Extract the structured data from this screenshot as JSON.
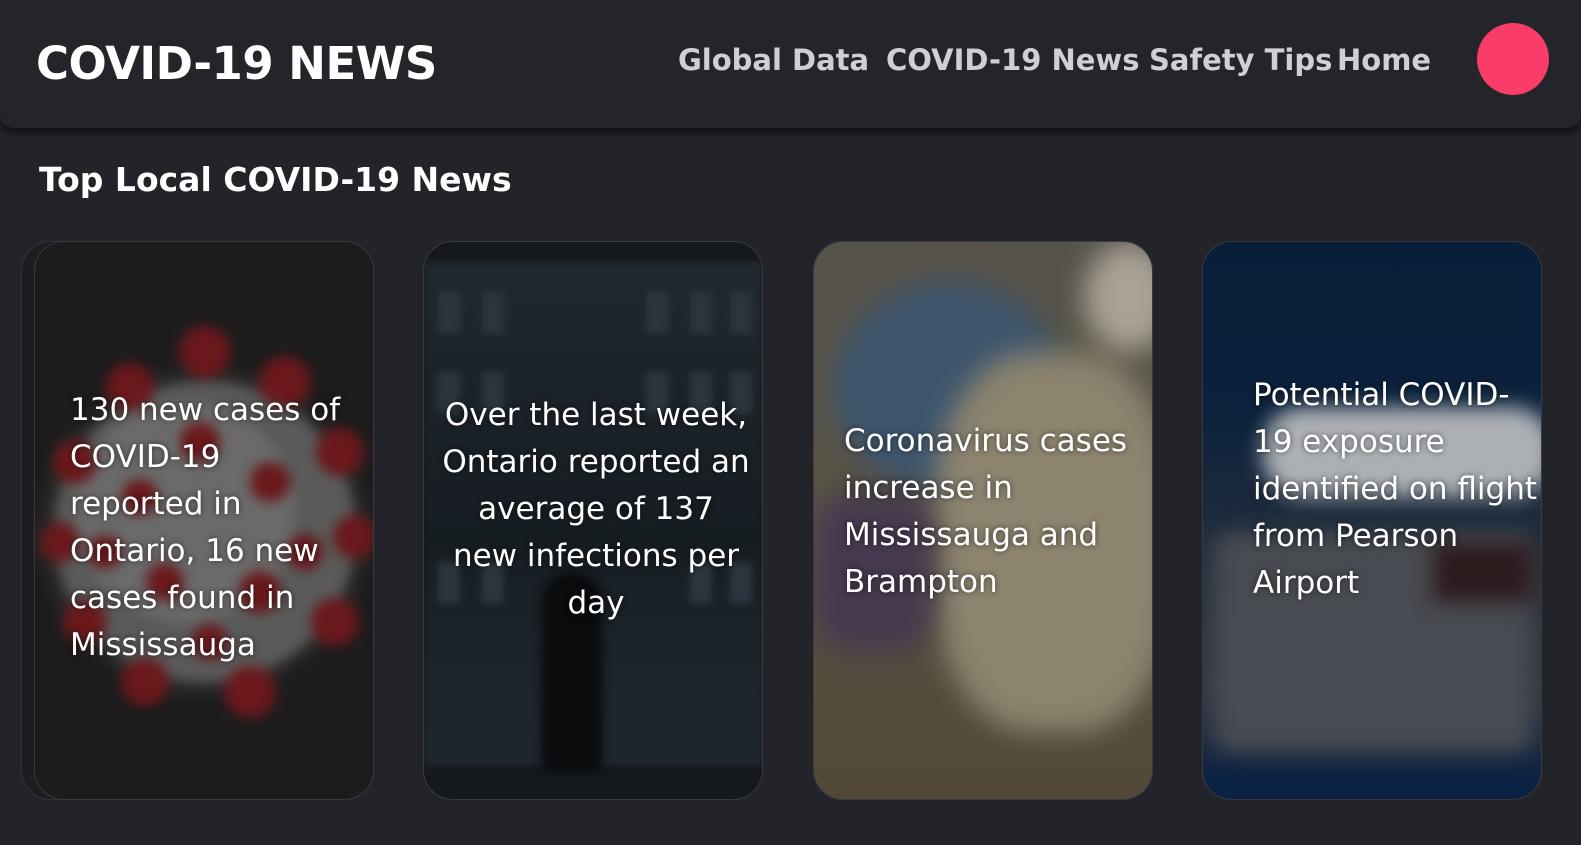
{
  "header": {
    "brand": "COVID-19 NEWS",
    "nav": {
      "global_data": "Global Data",
      "covid_news": "COVID-19 News",
      "safety_tips": "Safety Tips",
      "home": "Home"
    },
    "avatar_color": "#fa3d68"
  },
  "main": {
    "section_title": "Top Local COVID-19 News",
    "cards": [
      {
        "headline": "130 new cases of COVID-19 reported in Ontario, 16 new cases found in Mississauga",
        "image": "coronavirus-illustration"
      },
      {
        "headline": "Over the last week, Ontario reported an average of 137 new infections per day",
        "image": "person-walking-night"
      },
      {
        "headline": "Coronavirus cases increase in Mississauga and Brampton",
        "image": "gloved-hand-test-tubes"
      },
      {
        "headline": "Potential COVID-19 exposure identified on flight from Pearson Airport",
        "image": "airport-terminal-night"
      }
    ]
  },
  "colors": {
    "background": "#23242a",
    "navbar": "#24252b",
    "nav_text": "#cfd0d4",
    "accent": "#fa3d68"
  }
}
